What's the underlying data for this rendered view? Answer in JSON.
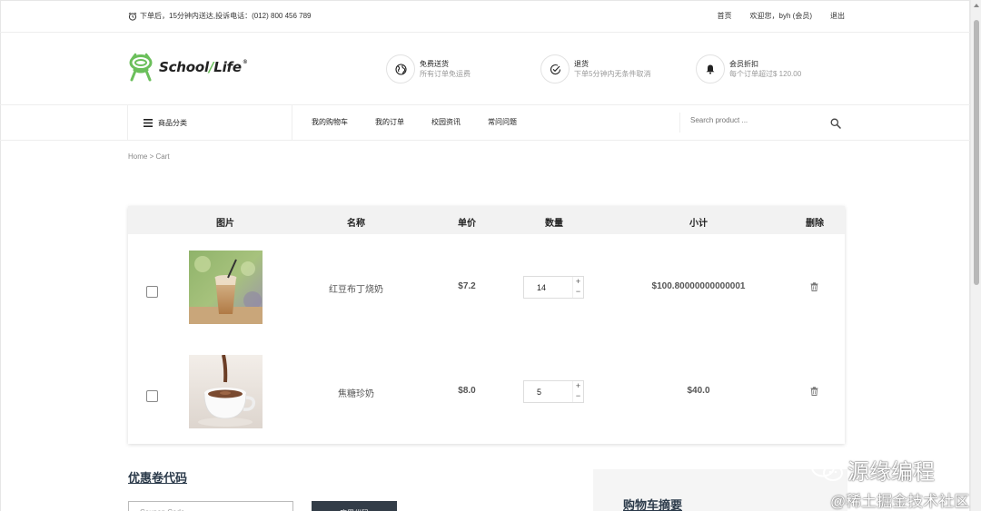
{
  "topbar": {
    "notice": "下单后，15分钟内送达,投诉电话：(012) 800 456 789",
    "links": [
      "首页",
      "欢迎您，byh (会员)",
      "退出"
    ]
  },
  "brand": {
    "part1": "School",
    "part2": "Life",
    "reg": "®"
  },
  "features": [
    {
      "icon": "globe-icon",
      "title": "免费送货",
      "sub": "所有订单免运费"
    },
    {
      "icon": "check-circle-icon",
      "title": "退货",
      "sub": "下单5分钟内无条件取消"
    },
    {
      "icon": "bell-icon",
      "title": "会员折扣",
      "sub": "每个订单超过$ 120.00"
    }
  ],
  "nav": {
    "category": "商品分类",
    "menu": [
      "我的购物车",
      "我的订单",
      "校园资讯",
      "常问问题"
    ],
    "search_placeholder": "Search product ..."
  },
  "breadcrumb": {
    "home": "Home",
    "separator": ">",
    "current": "Cart"
  },
  "cart": {
    "headers": [
      "图片",
      "名称",
      "单价",
      "数量",
      "小计",
      "删除"
    ],
    "items": [
      {
        "image": "iced-milk-tea",
        "name": "红豆布丁烧奶",
        "price": "$7.2",
        "quantity": "14",
        "subtotal": "$100.80000000000001"
      },
      {
        "image": "hot-chocolate",
        "name": "焦糖珍奶",
        "price": "$8.0",
        "quantity": "5",
        "subtotal": "$40.0"
      }
    ]
  },
  "coupon": {
    "title": "优惠卷代码",
    "placeholder": "Coupon Code",
    "button": "应用代码"
  },
  "summary": {
    "title": "购物车摘要"
  },
  "watermark": {
    "line1": "源缘编程",
    "line2": "@稀土掘金技术社区"
  },
  "colors": {
    "brand_green": "#6bbf5b",
    "dark_button": "#333d48",
    "table_header": "#f2f2f2"
  }
}
